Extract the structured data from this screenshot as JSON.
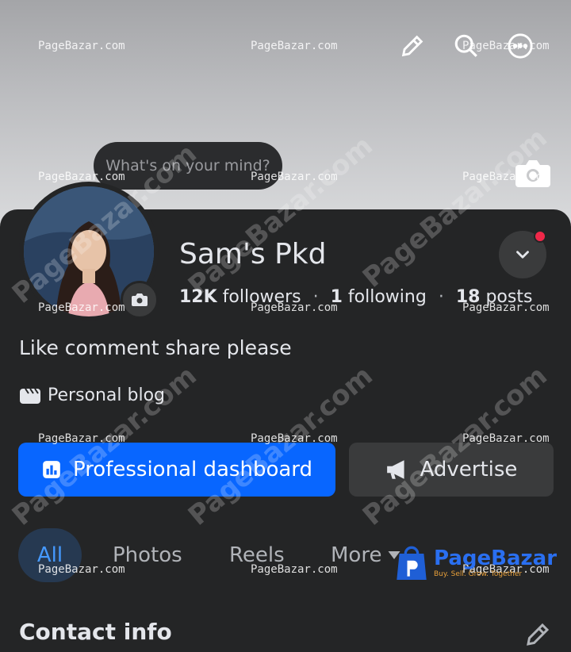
{
  "profile": {
    "name": "Sam's Pkd",
    "followers": "12K",
    "followers_label": "followers",
    "following": "1",
    "following_label": "following",
    "posts": "18",
    "posts_label": "posts",
    "separator": "·",
    "bio": "Like comment share please",
    "category": "Personal blog"
  },
  "cover": {
    "mind_prompt": "What's on your mind?"
  },
  "actions": {
    "professional_dashboard": "Professional dashboard",
    "advertise": "Advertise"
  },
  "tabs": [
    {
      "label": "All",
      "active": true
    },
    {
      "label": "Photos",
      "active": false
    },
    {
      "label": "Reels",
      "active": false
    },
    {
      "label": "More",
      "active": false
    }
  ],
  "sections": {
    "contact_info": "Contact info"
  },
  "watermark": {
    "text": "PageBazar.com",
    "big_text": "PageBazar.com",
    "logo_text": "PageBazar",
    "logo_sub": "Buy. Sell. Grow. Together"
  },
  "colors": {
    "accent": "#0866ff",
    "sheet_bg": "#242526",
    "notification": "#f02849"
  }
}
